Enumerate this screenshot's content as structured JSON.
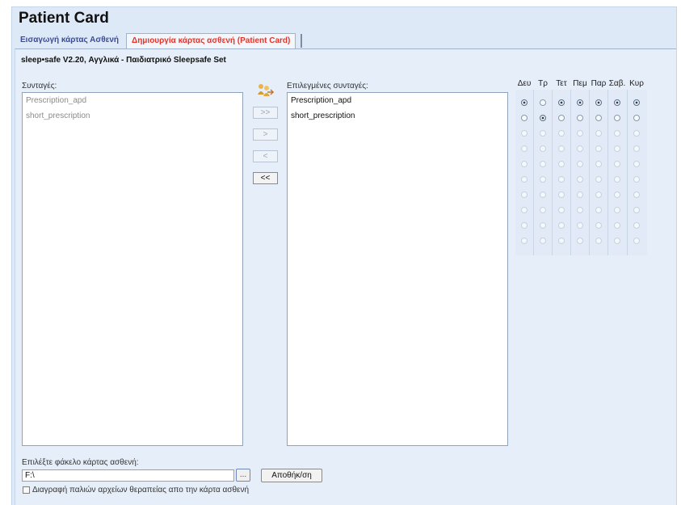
{
  "page_title": "Patient Card",
  "tabs": [
    {
      "label": "Εισαγωγή κάρτας Ασθενή"
    },
    {
      "label": "Δημιουργία κάρτας ασθενή (Patient Card)"
    }
  ],
  "device_line": "sleep•safe V2.20, Αγγλικά - Παιδιατρικό Sleepsafe Set",
  "prescriptions": {
    "label": "Συνταγές:",
    "items": [
      "Prescription_apd",
      "short_prescription"
    ]
  },
  "selected_prescriptions": {
    "label": "Επιλεγμένες συνταγές:",
    "items": [
      "Prescription_apd",
      "short_prescription"
    ]
  },
  "transfer_buttons": {
    "add_all": ">>",
    "add": ">",
    "remove": "<",
    "remove_all": "<<"
  },
  "icons": {
    "transfer": "people-arrow-icon",
    "browse": "ellipsis-icon"
  },
  "days": [
    "Δευ",
    "Τρ",
    "Τετ",
    "Πεμ",
    "Παρ",
    "Σαβ.",
    "Κυρ"
  ],
  "schedule_selection": [
    0,
    1,
    0,
    0,
    0,
    0,
    0
  ],
  "folder": {
    "label": "Επιλέξτε φάκελο κάρτας ασθενή:",
    "value": "F:\\",
    "browse_label": "...",
    "save_label": "Αποθήκ/ση"
  },
  "delete_old_files": {
    "label": "Διαγραφή παλιών αρχείων θεραπείας απο την κάρτα ασθενή",
    "checked": false
  }
}
